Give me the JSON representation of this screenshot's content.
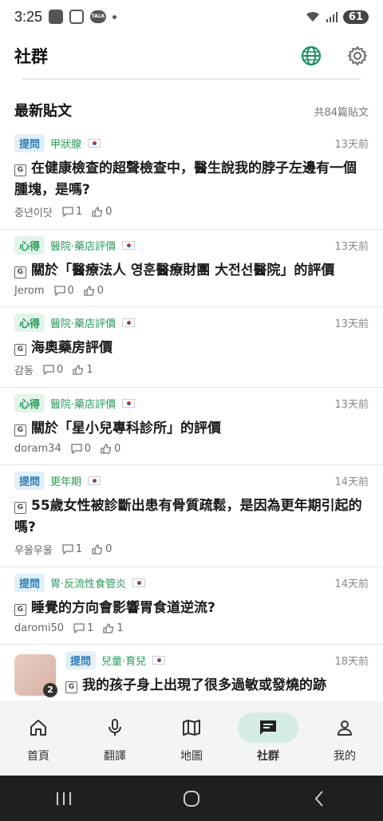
{
  "status_bar": {
    "time": "3:25",
    "talk_label": "TALK",
    "battery": "61"
  },
  "header": {
    "title": "社群"
  },
  "section": {
    "title": "最新貼文",
    "count": "共84篇貼文"
  },
  "translate_badge": "G",
  "posts": [
    {
      "tag": "提問",
      "category": "甲狀腺",
      "time": "13天前",
      "title": "在健康檢查的超聲檢查中，醫生說我的脖子左邊有一個腫塊，是嗎?",
      "author": "중년이닷",
      "comments": "1",
      "likes": "0"
    },
    {
      "tag": "心得",
      "category": "醫院·藥店評價",
      "time": "13天前",
      "title": "關於「醫療法人 영훈醫療財團 大전선醫院」的評價",
      "author": "Jerom",
      "comments": "0",
      "likes": "0"
    },
    {
      "tag": "心得",
      "category": "醫院·藥店評價",
      "time": "13天前",
      "title": "海奧藥房評價",
      "author": "감동",
      "comments": "0",
      "likes": "1"
    },
    {
      "tag": "心得",
      "category": "醫院·藥店評價",
      "time": "13天前",
      "title": "關於「星小兒專科診所」的評價",
      "author": "doram34",
      "comments": "0",
      "likes": "0"
    },
    {
      "tag": "提問",
      "category": "更年期",
      "time": "14天前",
      "title": "55歲女性被診斷出患有骨質疏鬆，是因為更年期引起的嗎?",
      "author": "우울우울",
      "comments": "1",
      "likes": "0"
    },
    {
      "tag": "提問",
      "category": "胃·反流性食管炎",
      "time": "14天前",
      "title": "睡覺的方向會影響胃食道逆流?",
      "author": "daromi50",
      "comments": "1",
      "likes": "1"
    },
    {
      "tag": "提問",
      "category": "兒童·育兒",
      "time": "18天前",
      "title": "我的孩子身上出現了很多過敏或發燒的跡",
      "thumb_count": "2"
    }
  ],
  "nav": [
    {
      "label": "首頁",
      "icon": "home-icon"
    },
    {
      "label": "翻譯",
      "icon": "microphone-icon"
    },
    {
      "label": "地圖",
      "icon": "map-icon"
    },
    {
      "label": "社群",
      "icon": "chat-icon"
    },
    {
      "label": "我的",
      "icon": "person-icon"
    }
  ],
  "colors": {
    "accent": "#2a9a5c",
    "question": "#2d7bb6",
    "nav_active_bg": "#d4ece4"
  }
}
